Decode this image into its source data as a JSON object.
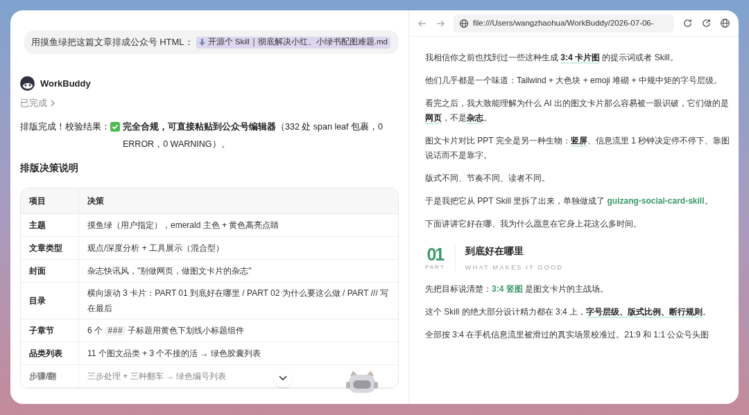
{
  "chat": {
    "user_message": {
      "text": "用摸鱼绿把这篇文章排成公众号 HTML：",
      "attachment": "开源个 Skill｜彻底解决小红、小绿书配图难题.md"
    },
    "assistant": {
      "name": "WorkBuddy",
      "status": "已完成",
      "result_prefix": "排版完成！校验结果：",
      "result_rest": "**完全合规，可直接粘贴到公众号编辑器**（332 处 span leaf 包裹，0 ERROR，0 WARNING）。",
      "heading": "排版决策说明"
    },
    "table": {
      "columns": [
        "项目",
        "决策"
      ],
      "rows": [
        {
          "item": "主题",
          "decision": [
            {
              "kind": "text",
              "text": "摸鱼绿（用户指定），emerald 主色 + 黄色高亮点睛"
            }
          ]
        },
        {
          "item": "文章类型",
          "decision": [
            {
              "kind": "text",
              "text": "观点/深度分析 + 工具展示（混合型）"
            }
          ]
        },
        {
          "item": "封面",
          "decision": [
            {
              "kind": "text",
              "text": "杂志快讯风，\"别做网页，做图文卡片的杂志\""
            }
          ]
        },
        {
          "item": "目录",
          "decision": [
            {
              "kind": "text",
              "text": "横向滚动 3 卡片：PART 01 到底好在哪里 / PART 02 为什么要这么做 / PART /// 写在最后"
            }
          ]
        },
        {
          "item": "子章节",
          "decision": [
            {
              "kind": "text",
              "text": "6 个 "
            },
            {
              "kind": "code",
              "text": "###"
            },
            {
              "kind": "text",
              "text": " 子标题用黄色下划线小标题组件"
            }
          ]
        },
        {
          "item": "品类列表",
          "decision": [
            {
              "kind": "text",
              "text": "11 个图文品类 + 3 个不接的活 → 绿色胶囊列表"
            }
          ]
        },
        {
          "item": "步骤/翻",
          "decision": [
            {
              "kind": "text",
              "text": "三步处理 + 三种翻车 → 绿色编号列表"
            }
          ]
        }
      ]
    }
  },
  "browser": {
    "url": "file:///Users/wangzhaohua/WorkBuddy/2026-07-06-",
    "article": [
      {
        "kind": "paragraph",
        "parts": [
          {
            "kind": "text",
            "text": "我相信你之前也找到过一些这种生成 "
          },
          {
            "kind": "strong",
            "text": "3:4 卡片图"
          },
          {
            "kind": "text",
            "text": " 的提示词或者 Skill。"
          }
        ]
      },
      {
        "kind": "paragraph",
        "parts": [
          {
            "kind": "text",
            "text": "他们几乎都是一个味道：Tailwind + 大色块 + emoji 堆砌 + 中规中矩的字号层级。"
          }
        ]
      },
      {
        "kind": "paragraph",
        "parts": [
          {
            "kind": "text",
            "text": "看完之后，我大致能理解为什么 AI 出的图文卡片那么容易被一眼识破，它们做的是"
          },
          {
            "kind": "strong",
            "text": "网页"
          },
          {
            "kind": "text",
            "text": "，不是"
          },
          {
            "kind": "strong",
            "text": "杂志"
          },
          {
            "kind": "text",
            "text": "。"
          }
        ]
      },
      {
        "kind": "paragraph",
        "parts": [
          {
            "kind": "text",
            "text": "图文卡片对比 PPT 完全是另一种生物："
          },
          {
            "kind": "strong",
            "text": "竖屏"
          },
          {
            "kind": "text",
            "text": "、信息流里 1 秒钟决定停不停下、靠图说话而不是靠字。"
          }
        ]
      },
      {
        "kind": "paragraph",
        "parts": [
          {
            "kind": "text",
            "text": "版式不同、节奏不同、读者不同。"
          }
        ]
      },
      {
        "kind": "paragraph",
        "parts": [
          {
            "kind": "text",
            "text": "于是我把它从 PPT Skill 里拆了出来，单独做成了 "
          },
          {
            "kind": "green",
            "text": "guizang-social-card-skill"
          },
          {
            "kind": "text",
            "text": "。"
          }
        ]
      },
      {
        "kind": "paragraph",
        "parts": [
          {
            "kind": "text",
            "text": "下面讲讲它好在哪、我为什么愿意在它身上花这么多时间。"
          }
        ]
      },
      {
        "kind": "section",
        "number": "01",
        "label": "PART",
        "title": "到底好在哪里",
        "subtitle": "WHAT MAKES IT GOOD"
      },
      {
        "kind": "paragraph",
        "parts": [
          {
            "kind": "text",
            "text": "先把目标说清楚："
          },
          {
            "kind": "green",
            "text": "3:4 竖图"
          },
          {
            "kind": "text",
            "text": " 是图文卡片的主战场。"
          }
        ]
      },
      {
        "kind": "paragraph",
        "parts": [
          {
            "kind": "text",
            "text": "这个 Skill 的绝大部分设计精力都在 3:4 上，"
          },
          {
            "kind": "strong",
            "text": "字号层级、版式比例、断行规则"
          },
          {
            "kind": "text",
            "text": "。"
          }
        ]
      },
      {
        "kind": "paragraph",
        "parts": [
          {
            "kind": "text",
            "text": "全部按 3:4 在手机信息流里被滑过的真实场景校准过。21:9 和 1:1 公众号头图"
          }
        ]
      }
    ]
  }
}
